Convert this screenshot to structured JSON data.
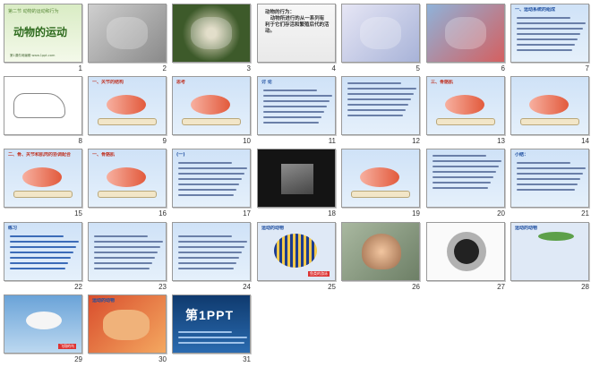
{
  "slides": [
    {
      "n": "1",
      "kind": "title",
      "title": "第二节 动物的运动和行为",
      "main": "动物的运动",
      "foot": "第1课件网编辑 www.1ppt.com"
    },
    {
      "n": "2",
      "kind": "photo"
    },
    {
      "n": "3",
      "kind": "photo"
    },
    {
      "n": "4",
      "kind": "text",
      "text": "动物的行为：\n   动物所进行的从一系列有\n利于它们存活和繁殖后代的活\n动。"
    },
    {
      "n": "5",
      "kind": "photo"
    },
    {
      "n": "6",
      "kind": "photo"
    },
    {
      "n": "7",
      "kind": "text",
      "text": "一、运动系统的组成"
    },
    {
      "n": "8",
      "kind": "skeleton"
    },
    {
      "n": "9",
      "kind": "diagram",
      "text": "一、关节的结构"
    },
    {
      "n": "10",
      "kind": "diagram",
      "text": "思考"
    },
    {
      "n": "11",
      "kind": "text",
      "text": "讨 论"
    },
    {
      "n": "12",
      "kind": "text",
      "text": ""
    },
    {
      "n": "13",
      "kind": "muscle",
      "text": "三、骨骼肌"
    },
    {
      "n": "14",
      "kind": "muscle",
      "text": ""
    },
    {
      "n": "15",
      "kind": "muscle",
      "text": "二、骨、关节和肌肉的协调配合"
    },
    {
      "n": "16",
      "kind": "muscle",
      "text": "一、骨骼肌"
    },
    {
      "n": "17",
      "kind": "text",
      "text": "(一) "
    },
    {
      "n": "18",
      "kind": "dark"
    },
    {
      "n": "19",
      "kind": "muscle",
      "text": ""
    },
    {
      "n": "20",
      "kind": "text",
      "text": ""
    },
    {
      "n": "21",
      "kind": "text",
      "text": "小结："
    },
    {
      "n": "22",
      "kind": "text",
      "text": "练习"
    },
    {
      "n": "23",
      "kind": "text",
      "text": ""
    },
    {
      "n": "24",
      "kind": "text",
      "text": ""
    },
    {
      "n": "25",
      "kind": "fish",
      "label": "运动的动物",
      "chip": "鱼类的游泳"
    },
    {
      "n": "26",
      "kind": "butterfly"
    },
    {
      "n": "27",
      "kind": "spider"
    },
    {
      "n": "28",
      "kind": "lizard",
      "label": "运动的动物"
    },
    {
      "n": "29",
      "kind": "bird",
      "chip": "飞翔的鸟"
    },
    {
      "n": "30",
      "kind": "coral",
      "label": "运动的动物"
    },
    {
      "n": "31",
      "kind": "logo",
      "logo": "第1PPT"
    }
  ],
  "colors": {
    "accent_red": "#c0392b",
    "accent_blue": "#1f4fa0",
    "slide_blue": "#cfe2f7"
  }
}
